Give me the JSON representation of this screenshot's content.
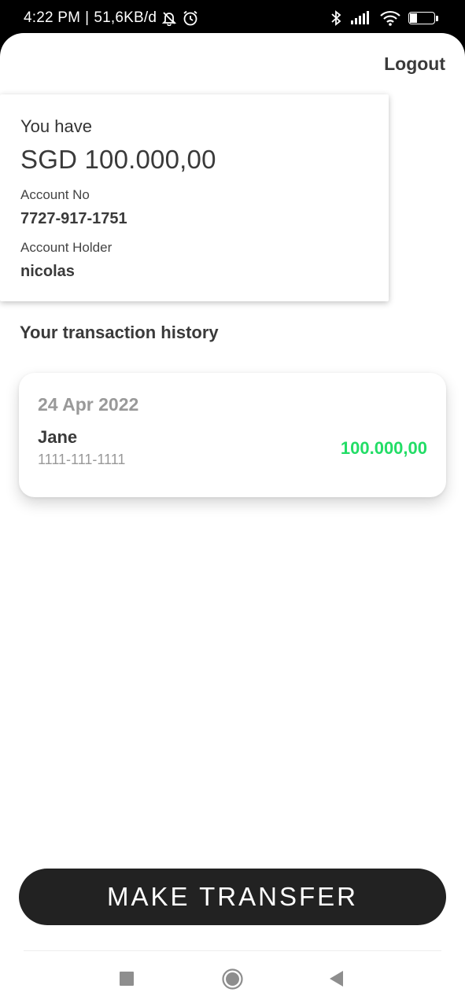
{
  "status_bar": {
    "time": "4:22 PM",
    "separator": "|",
    "network_speed": "51,6KB/d",
    "battery_level": "35",
    "battery_fraction": 0.35,
    "icons": [
      "bell-muted-icon",
      "alarm-icon",
      "bluetooth-icon",
      "signal-icon",
      "wifi-icon",
      "battery-icon"
    ]
  },
  "header": {
    "logout_label": "Logout"
  },
  "account": {
    "balance_heading": "You have",
    "balance": "SGD 100.000,00",
    "account_no_label": "Account No",
    "account_no": "7727-917-1751",
    "holder_label": "Account Holder",
    "holder": "nicolas"
  },
  "history": {
    "title": "Your transaction history",
    "transactions": [
      {
        "date": "24 Apr 2022",
        "name": "Jane",
        "account_no": "1111-111-1111",
        "amount": "100.000,00"
      }
    ]
  },
  "actions": {
    "transfer_label": "MAKE TRANSFER"
  },
  "nav": {
    "icons": [
      "recents-square-icon",
      "home-circle-icon",
      "back-triangle-icon"
    ]
  },
  "colors": {
    "amount_positive": "#22dd66",
    "button_bg": "#222222",
    "text_primary": "#3a3a3a",
    "text_muted": "#999999"
  }
}
